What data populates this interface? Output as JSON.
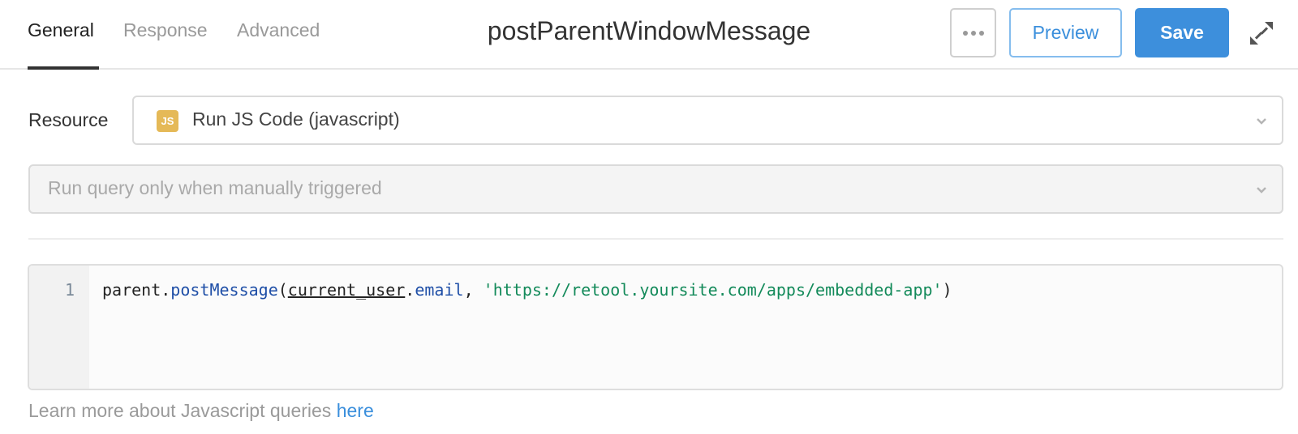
{
  "header": {
    "tabs": [
      {
        "label": "General",
        "active": true
      },
      {
        "label": "Response",
        "active": false
      },
      {
        "label": "Advanced",
        "active": false
      }
    ],
    "title": "postParentWindowMessage",
    "more_icon": "ellipsis-icon",
    "preview_label": "Preview",
    "save_label": "Save",
    "expand_icon": "expand-arrows-icon"
  },
  "resource": {
    "label": "Resource",
    "badge": "JS",
    "value": "Run JS Code (javascript)"
  },
  "trigger": {
    "value": "Run query only when manually triggered"
  },
  "editor": {
    "line_number": "1",
    "tokens": {
      "obj": "parent",
      "dot1": ".",
      "fn": "postMessage",
      "open": "(",
      "var": "current_user",
      "dot2": ".",
      "prop": "email",
      "comma": ", ",
      "str": "'https://retool.yoursite.com/apps/embedded-app'",
      "close": ")"
    }
  },
  "footer": {
    "text": "Learn more about Javascript queries ",
    "link": "here"
  },
  "colors": {
    "accent": "#3d8fdc",
    "js_badge": "#e5b957",
    "string": "#138a5a",
    "function": "#1f4fa7"
  }
}
